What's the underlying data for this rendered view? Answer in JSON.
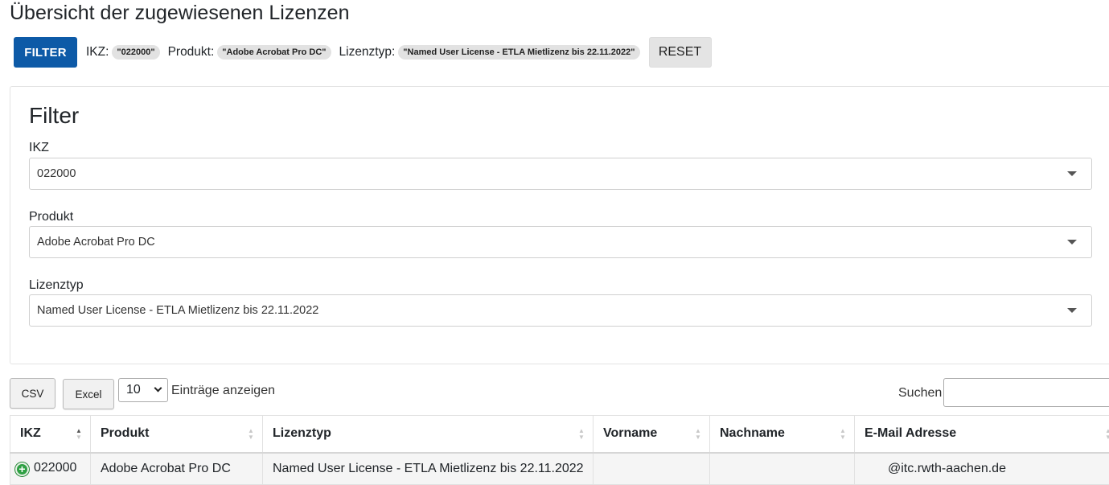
{
  "page": {
    "title": "Übersicht der zugewiesenen Lizenzen"
  },
  "filter_bar": {
    "filter_button": "FILTER",
    "ikz_label": "IKZ:",
    "ikz_chip": "\"022000\"",
    "produkt_label": "Produkt:",
    "produkt_chip": "\"Adobe Acrobat Pro DC\"",
    "lizenztyp_label": "Lizenztyp:",
    "lizenztyp_chip": "\"Named User License - ETLA Mietlizenz bis 22.11.2022\"",
    "reset_button": "RESET"
  },
  "filter_panel": {
    "title": "Filter",
    "fields": [
      {
        "label": "IKZ",
        "value": "022000"
      },
      {
        "label": "Produkt",
        "value": "Adobe Acrobat Pro DC"
      },
      {
        "label": "Lizenztyp",
        "value": "Named User License - ETLA Mietlizenz bis 22.11.2022"
      }
    ]
  },
  "toolbar": {
    "csv_button": "CSV",
    "excel_button": "Excel",
    "page_length": "10",
    "page_length_text": "Einträge anzeigen",
    "search_label": "Suchen",
    "search_value": ""
  },
  "table": {
    "columns": [
      "IKZ",
      "Produkt",
      "Lizenztyp",
      "Vorname",
      "Nachname",
      "E-Mail Adresse"
    ],
    "rows": [
      {
        "ikz": "022000",
        "produkt": "Adobe Acrobat Pro DC",
        "lizenztyp": "Named User License - ETLA Mietlizenz bis 22.11.2022",
        "vorname": "",
        "nachname": "",
        "email": "@itc.rwth-aachen.de"
      }
    ]
  },
  "colors": {
    "primary": "#0d5aa7",
    "expand_icon": "#2ea043"
  }
}
